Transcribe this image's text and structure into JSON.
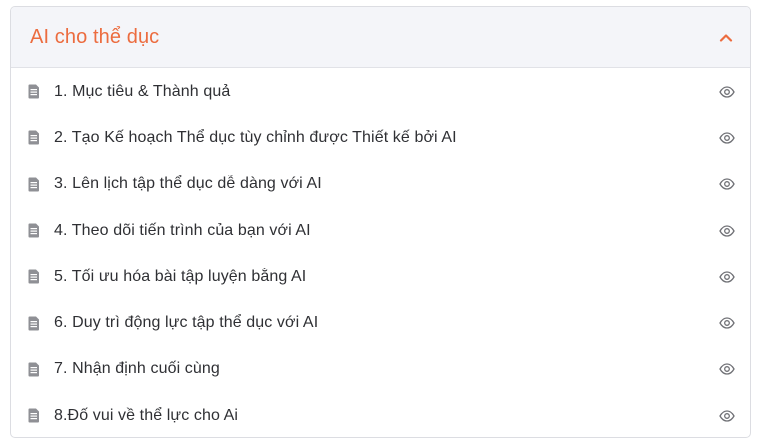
{
  "section": {
    "title": "AI cho thể dục",
    "expanded_icon": "chevron-up-icon",
    "accent_color": "#ec6c3f"
  },
  "lessons": [
    {
      "title": "1. Mục tiêu & Thành quả",
      "type_icon": "document-icon",
      "action_icon": "eye-icon"
    },
    {
      "title": "2. Tạo Kế hoạch Thể dục tùy chỉnh được Thiết kế bởi AI",
      "type_icon": "document-icon",
      "action_icon": "eye-icon"
    },
    {
      "title": "3. Lên lịch tập thể dục dễ dàng với AI",
      "type_icon": "document-icon",
      "action_icon": "eye-icon"
    },
    {
      "title": "4. Theo dõi tiến trình của bạn với AI",
      "type_icon": "document-icon",
      "action_icon": "eye-icon"
    },
    {
      "title": "5. Tối ưu hóa bài tập luyện bằng AI",
      "type_icon": "document-icon",
      "action_icon": "eye-icon"
    },
    {
      "title": "6. Duy trì động lực tập thể dục với AI",
      "type_icon": "document-icon",
      "action_icon": "eye-icon"
    },
    {
      "title": "7. Nhận định cuối cùng",
      "type_icon": "document-icon",
      "action_icon": "eye-icon"
    },
    {
      "title": "8.Đố vui về thể lực cho Ai",
      "type_icon": "document-icon",
      "action_icon": "eye-icon"
    }
  ]
}
